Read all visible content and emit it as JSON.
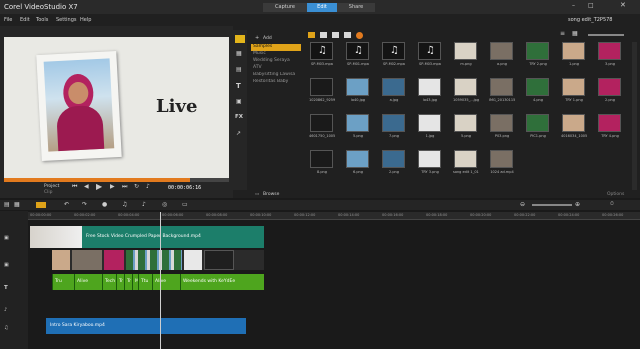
{
  "app": {
    "title": "Corel VideoStudio X7",
    "project": "song edit_T2P578"
  },
  "tabs": [
    "Capture",
    "Edit",
    "Share"
  ],
  "menu": [
    "File",
    "Edit",
    "Tools",
    "Settings",
    "Help"
  ],
  "preview": {
    "caption": "Live",
    "project_label": "Project",
    "clip_label": "Clip",
    "timecode": "00:00:06:16"
  },
  "library": {
    "add_label": "Add",
    "browse_label": "Browse",
    "options_label": "Options",
    "categories": [
      "Samples",
      "Music",
      "Wedding Seraya",
      "ATV",
      "Babysitting Lawisa",
      "Restoritas Baby"
    ],
    "items": [
      {
        "label": "SP-M03.mpa"
      },
      {
        "label": "SP-M01.mpa"
      },
      {
        "label": "SP-M02.mpa"
      },
      {
        "label": "SP-M03.mpa"
      },
      {
        "label": "m.png"
      },
      {
        "label": "a.png"
      },
      {
        "label": "TRY 2.png"
      },
      {
        "label": "1.png"
      },
      {
        "label": "3.png"
      },
      {
        "label": "1020862_92597008..."
      },
      {
        "label": "lo40.jpg"
      },
      {
        "label": "a.jpg"
      },
      {
        "label": "lo43.jpg"
      },
      {
        "label": "1059035_...jpg"
      },
      {
        "label": "IMG_20130115_1..."
      },
      {
        "label": "4.png"
      },
      {
        "label": "TRY 1.png"
      },
      {
        "label": "2.png"
      },
      {
        "label": "4601750_10055..."
      },
      {
        "label": "5.png"
      },
      {
        "label": "7.png"
      },
      {
        "label": "1.jpg"
      },
      {
        "label": "5.png"
      },
      {
        "label": "P03.png"
      },
      {
        "label": "PIC1.png"
      },
      {
        "label": "4016034_10055..."
      },
      {
        "label": "TRY 4.png"
      },
      {
        "label": "8.png"
      },
      {
        "label": "6.png"
      },
      {
        "label": "2.png"
      },
      {
        "label": "TRY 3.png"
      },
      {
        "label": "song edit 1_01.mp4"
      },
      {
        "label": "1024 ad.mp4"
      }
    ]
  },
  "timeline": {
    "ruler": [
      "00:00:00:00",
      "00:00:02:00",
      "00:00:04:00",
      "00:00:06:00",
      "00:00:08:00",
      "00:00:10:00",
      "00:00:12:00",
      "00:00:14:00",
      "00:00:16:00",
      "00:00:18:00",
      "00:00:20:00",
      "00:00:22:00",
      "00:00:24:00",
      "00:00:26:00"
    ],
    "clips": [
      {
        "label": "Free Stock Video Crumpled Paper Background.mp4"
      },
      {
        "label": "Intro Sara Kiryaboo.mp4"
      }
    ],
    "titles": [
      "Tru",
      "Alive",
      "Tech",
      "Tr",
      "Tr",
      "M",
      "Ttu",
      "Alive",
      "Weekends with KeYdEe"
    ],
    "playhead_position": 0.24
  }
}
